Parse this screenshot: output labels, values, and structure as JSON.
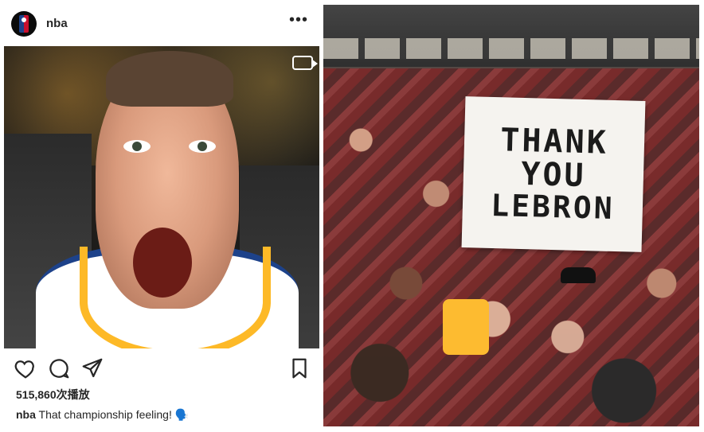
{
  "post": {
    "username": "nba",
    "more_label": "•••",
    "views_text": "515,860次播放",
    "caption_user": "nba",
    "caption_text": "That championship feeling! 🗣️"
  },
  "sign": {
    "line1": "THANK",
    "line2": "YOU",
    "line3": "LEBRON"
  },
  "icons": [
    "heart-icon",
    "comment-icon",
    "share-icon",
    "bookmark-icon",
    "video-icon",
    "more-icon"
  ]
}
